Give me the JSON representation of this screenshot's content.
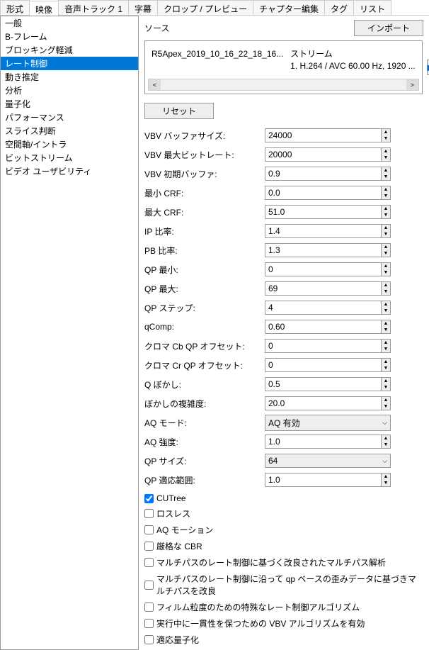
{
  "tabs": [
    "形式",
    "映像",
    "音声トラック 1",
    "字幕",
    "クロップ / プレビュー",
    "チャプター編集",
    "タグ",
    "リスト"
  ],
  "active_tab": 1,
  "sidebar": {
    "items": [
      "一般",
      "B-フレーム",
      "ブロッキング軽減",
      "レート制御",
      "動き推定",
      "分析",
      "量子化",
      "パフォーマンス",
      "スライス判断",
      "空間軸/イントラ",
      "ビットストリーム",
      "ビデオ ユーザビリティ"
    ],
    "selected": 3
  },
  "source": {
    "group_label": "ソース",
    "import_btn": "インポート",
    "col1_header": "",
    "col1_value": "R5Apex_2019_10_16_22_18_16...",
    "col2_header": "ストリーム",
    "col2_value": "1. H.264 / AVC  60.00 Hz, 1920 ..."
  },
  "reset_btn": "リセット",
  "fields": [
    {
      "label": "VBV バッファサイズ:",
      "type": "num",
      "value": "24000"
    },
    {
      "label": "VBV 最大ビットレート:",
      "type": "num",
      "value": "20000"
    },
    {
      "label": "VBV 初期バッファ:",
      "type": "num",
      "value": "0.9"
    },
    {
      "label": "最小 CRF:",
      "type": "num",
      "value": "0.0"
    },
    {
      "label": "最大 CRF:",
      "type": "num",
      "value": "51.0"
    },
    {
      "label": "IP 比率:",
      "type": "num",
      "value": "1.4"
    },
    {
      "label": "PB 比率:",
      "type": "num",
      "value": "1.3"
    },
    {
      "label": "QP 最小:",
      "type": "num",
      "value": "0"
    },
    {
      "label": "QP 最大:",
      "type": "num",
      "value": "69"
    },
    {
      "label": "QP ステップ:",
      "type": "num",
      "value": "4"
    },
    {
      "label": "qComp:",
      "type": "num",
      "value": "0.60"
    },
    {
      "label": "クロマ Cb QP オフセット:",
      "type": "num",
      "value": "0"
    },
    {
      "label": "クロマ Cr QP オフセット:",
      "type": "num",
      "value": "0"
    },
    {
      "label": "Q ぼかし:",
      "type": "num",
      "value": "0.5"
    },
    {
      "label": "ぼかしの複雑度:",
      "type": "num",
      "value": "20.0"
    },
    {
      "label": "AQ モード:",
      "type": "select",
      "value": "AQ 有効"
    },
    {
      "label": "AQ 強度:",
      "type": "num",
      "value": "1.0"
    },
    {
      "label": "QP サイズ:",
      "type": "select",
      "value": "64"
    },
    {
      "label": "QP 適応範囲:",
      "type": "num",
      "value": "1.0"
    }
  ],
  "checks": [
    {
      "label": "CUTree",
      "checked": true
    },
    {
      "label": "ロスレス",
      "checked": false
    },
    {
      "label": "AQ モーション",
      "checked": false
    },
    {
      "label": "厳格な CBR",
      "checked": false
    },
    {
      "label": "マルチパスのレート制御に基づく改良されたマルチパス解析",
      "checked": false
    },
    {
      "label": "マルチパスのレート制御に沿って qp ベースの歪みデータに基づきマルチパスを改良",
      "checked": false
    },
    {
      "label": "フィルム粒度のための特殊なレート制御アルゴリズム",
      "checked": false
    },
    {
      "label": "実行中に一貫性を保つための VBV アルゴリズムを有効",
      "checked": false
    },
    {
      "label": "適応量子化",
      "checked": false
    }
  ]
}
